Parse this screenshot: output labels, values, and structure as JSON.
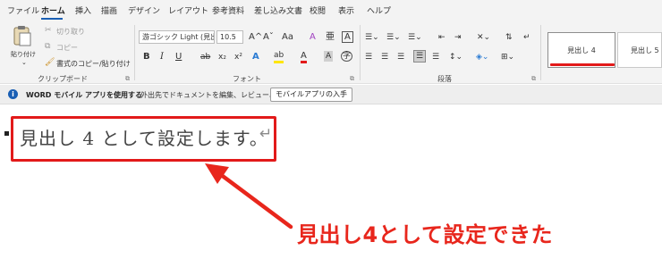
{
  "menu": {
    "tabs": [
      "ファイル",
      "ホーム",
      "挿入",
      "描画",
      "デザイン",
      "レイアウト",
      "参考資料",
      "差し込み文書",
      "校閲",
      "表示",
      "ヘルプ"
    ],
    "active_tab": "ホーム"
  },
  "clipboard": {
    "paste_label": "貼り付け",
    "cut_label": "切り取り",
    "copy_label": "コピー",
    "format_painter_label": "書式のコピー/貼り付け",
    "group_label": "クリップボード"
  },
  "font": {
    "font_name": "游ゴシック Light (見出",
    "font_size": "10.5",
    "grow_label": "A^",
    "shrink_label": "Aˇ",
    "case_label": "Aa",
    "clear_label": "A",
    "phonetic_label": "亜",
    "box_label": "A",
    "bold_label": "B",
    "italic_label": "I",
    "underline_label": "U",
    "strike_label": "ab",
    "subscript_label": "x₂",
    "superscript_label": "x²",
    "effects_label": "A",
    "highlight_label": "ab",
    "color_label": "A",
    "shade_label": "A",
    "enclose_label": "字",
    "group_label": "フォント"
  },
  "paragraph": {
    "group_label": "段落"
  },
  "styles": {
    "cards": [
      "見出し 4",
      "見出し 5"
    ],
    "selected": "見出し 4"
  },
  "infobar": {
    "bold_text": "WORD モバイル アプリを使用する",
    "message": "外出先でドキュメントを編集、レビュー、共有",
    "button_label": "モバイルアプリの入手"
  },
  "document": {
    "heading_text": "見出し 4 として設定します。",
    "paragraph_mark": "↵"
  },
  "annotation": {
    "callout_text": "見出し4として設定できた",
    "accent_color": "#e21a1a"
  }
}
